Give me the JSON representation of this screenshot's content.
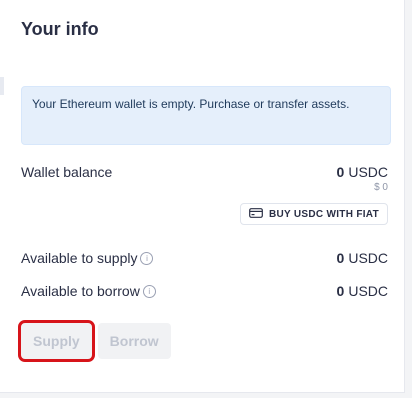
{
  "panel": {
    "title": "Your info",
    "alert": "Your Ethereum wallet is empty. Purchase or transfer assets.",
    "wallet_balance": {
      "label": "Wallet balance",
      "amount": "0",
      "currency": "USDC",
      "fiat": "$ 0"
    },
    "buy_button_label": "BUY USDC WITH FIAT",
    "available_supply": {
      "label": "Available to supply",
      "amount": "0",
      "currency": "USDC"
    },
    "available_borrow": {
      "label": "Available to borrow",
      "amount": "0",
      "currency": "USDC"
    },
    "actions": {
      "supply": "Supply",
      "borrow": "Borrow"
    }
  },
  "icons": {
    "info": "info-icon",
    "card": "card-icon"
  },
  "colors": {
    "highlight": "#d7141a",
    "alert_bg": "#e5effb",
    "text": "#2a2f45",
    "disabled_text": "#c0c5d0"
  }
}
